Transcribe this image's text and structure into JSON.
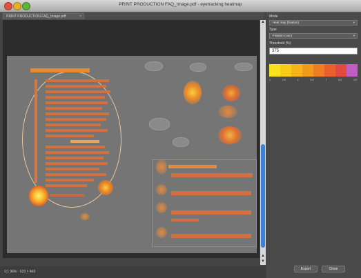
{
  "window": {
    "title": "PRINT PRODUCTION FAQ_Image.pdf - eyetracking heatmap"
  },
  "tab": {
    "label": "PRINT PRODUCTION FAQ_Image.pdf"
  },
  "status": {
    "text": "1:1  96% · 523 × 403"
  },
  "panel": {
    "mode_label": "Mode",
    "mode_value": "Heat map (fixation)",
    "type_label": "Type",
    "type_value": "Fixation count",
    "threshold_label": "Threshold (%)",
    "threshold_value": "375",
    "ramp_colors": [
      "#f7e21d",
      "#f9cc18",
      "#f7b318",
      "#f29a1c",
      "#ee7e23",
      "#e9622c",
      "#e34b40",
      "#c25cc3"
    ],
    "ticks": [
      "1",
      "2.5",
      "4",
      "5.5",
      "7",
      "8.5",
      "10+"
    ],
    "export_label": "Export",
    "close_label": "Close"
  }
}
